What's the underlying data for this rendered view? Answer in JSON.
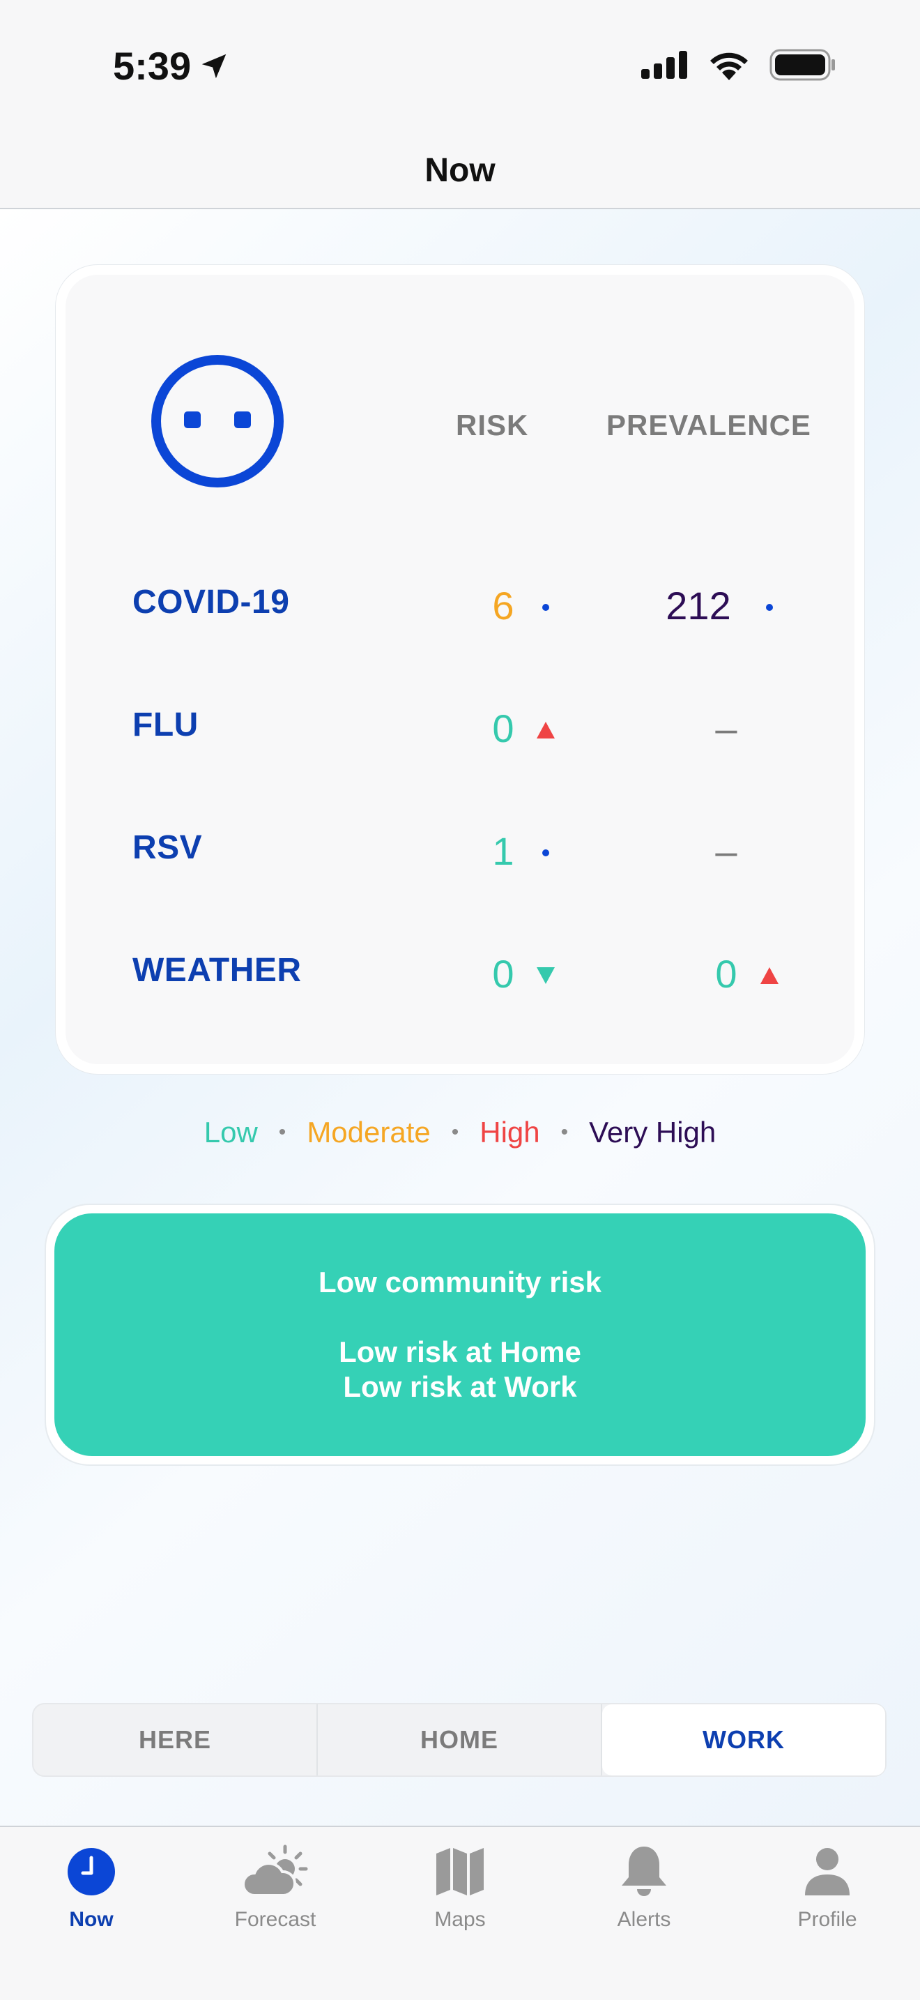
{
  "status_bar": {
    "time": "5:39"
  },
  "nav": {
    "title": "Now"
  },
  "table": {
    "headers": {
      "risk": "RISK",
      "prevalence": "PREVALENCE"
    },
    "rows": [
      {
        "label": "COVID-19",
        "risk": "6",
        "risk_color": "#f5a623",
        "risk_indicator": "dot",
        "prevalence": "212",
        "prevalence_color": "#2d0d55",
        "prevalence_indicator": "dot"
      },
      {
        "label": "FLU",
        "risk": "0",
        "risk_color": "#35c9ad",
        "risk_indicator": "up",
        "prevalence": "–",
        "prevalence_color": "#7b7b7b",
        "prevalence_indicator": "none"
      },
      {
        "label": "RSV",
        "risk": "1",
        "risk_color": "#35c9ad",
        "risk_indicator": "dot",
        "prevalence": "–",
        "prevalence_color": "#7b7b7b",
        "prevalence_indicator": "none"
      },
      {
        "label": "WEATHER",
        "risk": "0",
        "risk_color": "#35c9ad",
        "risk_indicator": "down",
        "prevalence": "0",
        "prevalence_color": "#35c9ad",
        "prevalence_indicator": "up"
      }
    ]
  },
  "legend": {
    "low": "Low",
    "moderate": "Moderate",
    "high": "High",
    "very_high": "Very High",
    "colors": {
      "low": "#35c9ad",
      "moderate": "#f5a623",
      "high": "#ef4444",
      "very_high": "#2d0d55"
    }
  },
  "banner": {
    "line1": "Low community risk",
    "line2": "Low risk at Home",
    "line3": "Low risk at Work"
  },
  "location_tabs": {
    "here": "HERE",
    "home": "HOME",
    "work": "WORK"
  },
  "tabbar": {
    "now": "Now",
    "forecast": "Forecast",
    "maps": "Maps",
    "alerts": "Alerts",
    "profile": "Profile"
  },
  "colors": {
    "brand": "#0d3fb0",
    "accent_blue": "#0b46d6",
    "up_arrow": "#ef4444",
    "down_arrow": "#35c9ad"
  }
}
